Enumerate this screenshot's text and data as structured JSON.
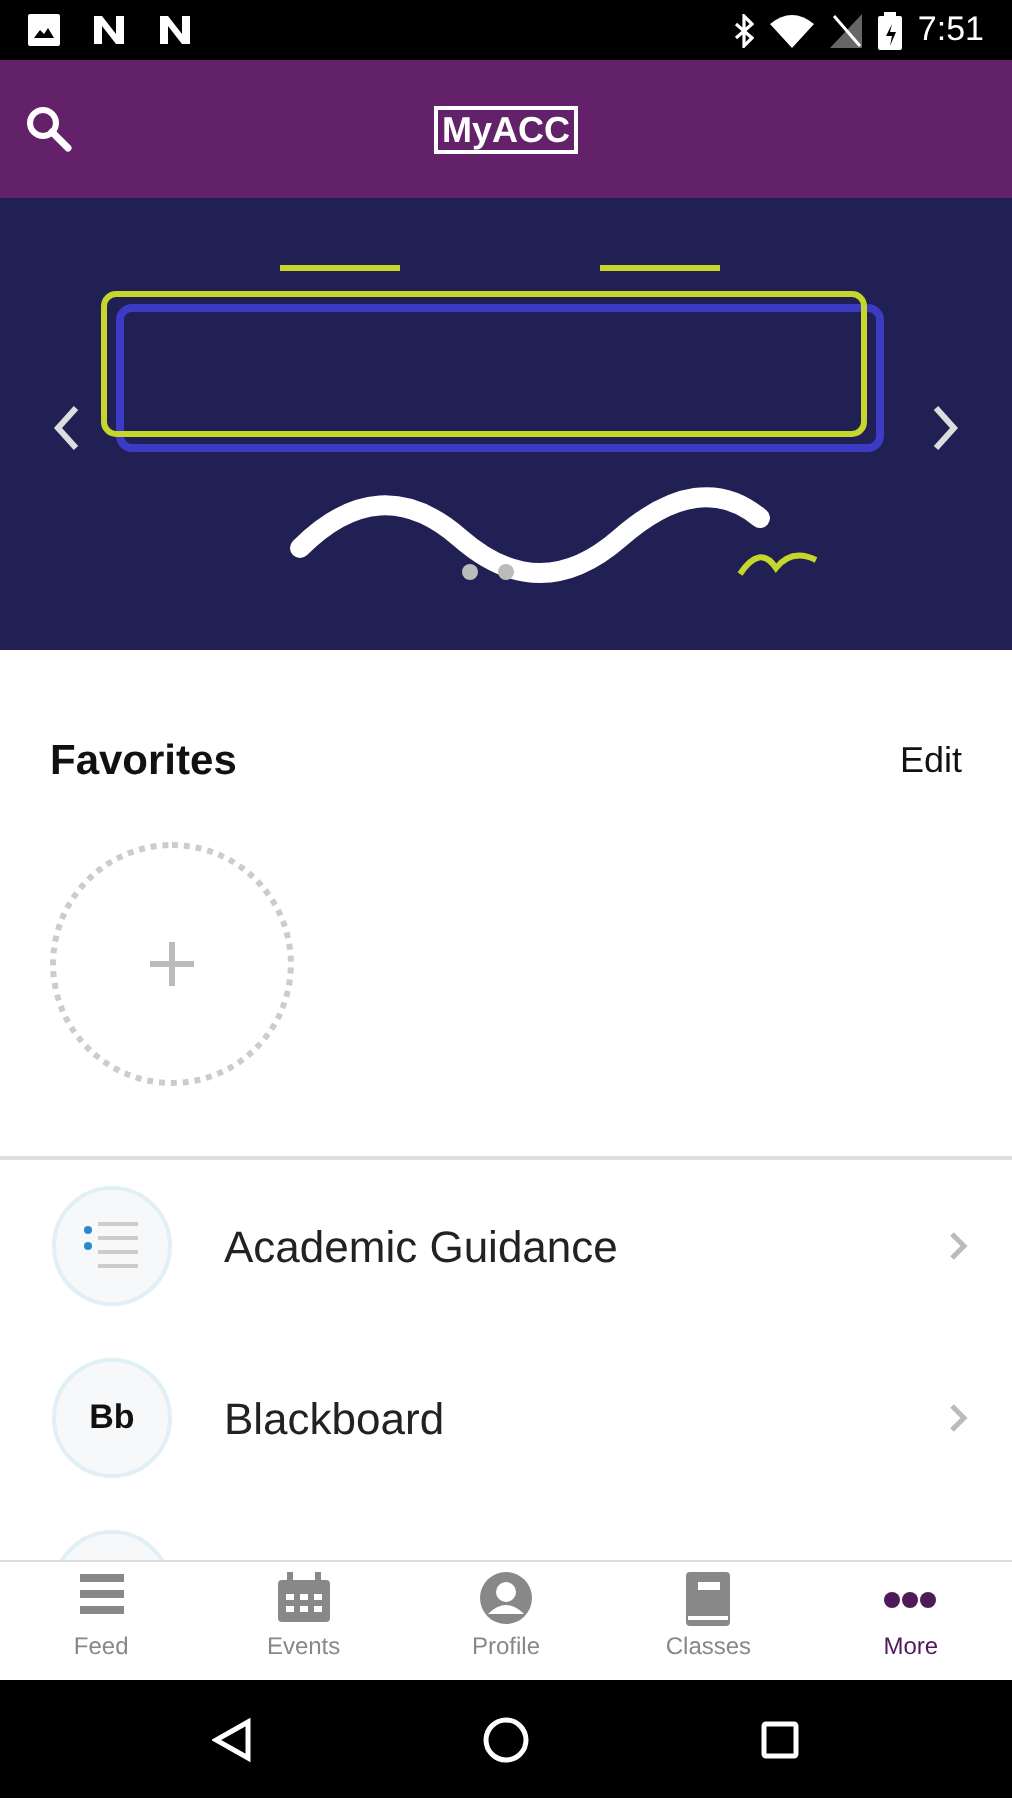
{
  "status_bar": {
    "time": "7:51"
  },
  "app_bar": {
    "logo": "MyACC"
  },
  "favorites": {
    "title": "Favorites",
    "edit": "Edit"
  },
  "list": [
    {
      "label": "Academic Guidance",
      "kind": "list"
    },
    {
      "label": "Blackboard",
      "kind": "text",
      "icon_text": "Bb"
    },
    {
      "kind": "partial"
    }
  ],
  "tabs": [
    {
      "label": "Feed",
      "kind": "feed",
      "selected": false
    },
    {
      "label": "Events",
      "kind": "calendar",
      "selected": false
    },
    {
      "label": "Profile",
      "kind": "profile",
      "selected": false
    },
    {
      "label": "Classes",
      "kind": "book",
      "selected": false
    },
    {
      "label": "More",
      "kind": "more",
      "selected": true
    }
  ]
}
